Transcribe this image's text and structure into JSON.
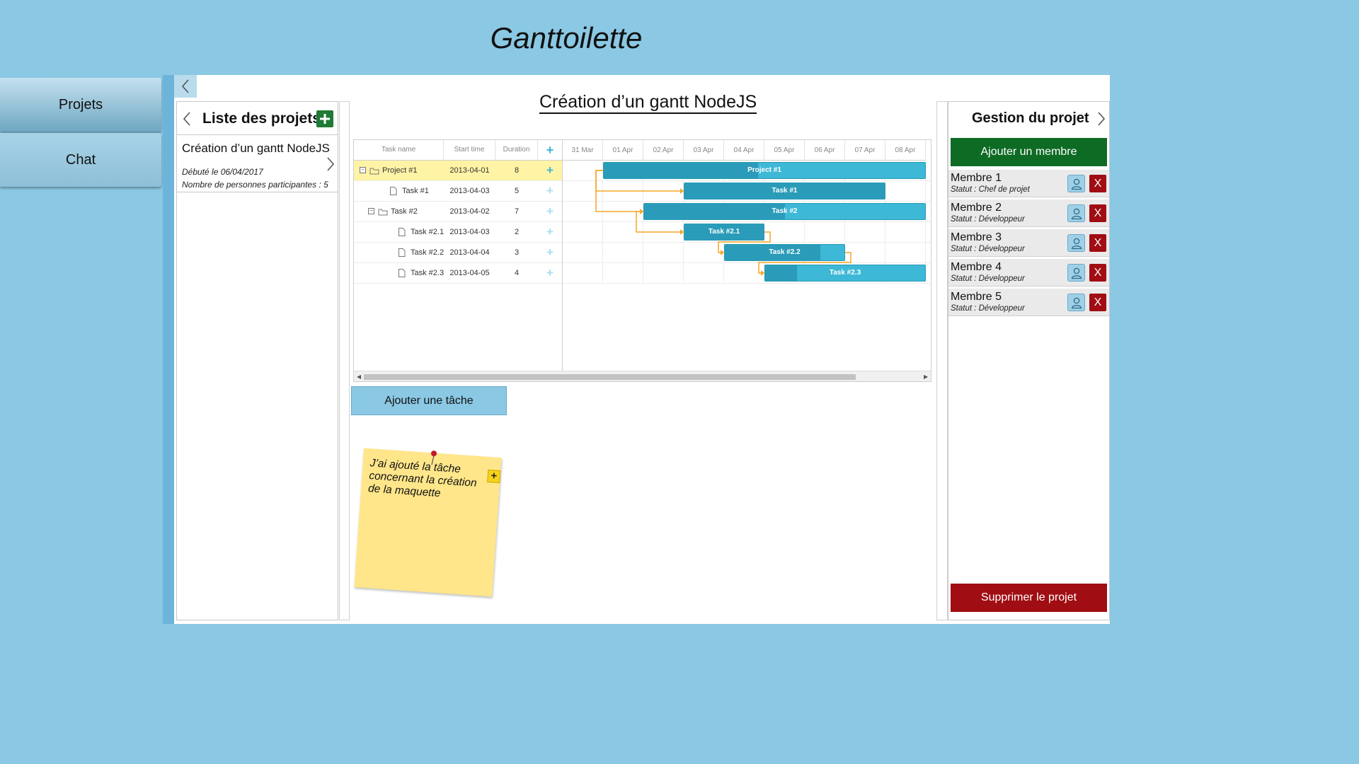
{
  "app": {
    "title": "Ganttoilette"
  },
  "sidebar": {
    "items": [
      {
        "label": "Projets"
      },
      {
        "label": "Chat"
      }
    ]
  },
  "projects_panel": {
    "title": "Liste des projets",
    "items": [
      {
        "name": "Création d’un gantt NodeJS",
        "started": "Débuté le 06/04/2017",
        "participants": "Nombre de personnes participantes : 5"
      }
    ]
  },
  "project": {
    "title": "Création d’un gantt NodeJS"
  },
  "gantt": {
    "columns": {
      "name": "Task name",
      "start": "Start time",
      "duration": "Duration",
      "add": "+"
    },
    "dates": [
      "31 Mar",
      "01 Apr",
      "02 Apr",
      "03 Apr",
      "04 Apr",
      "05 Apr",
      "06 Apr",
      "07 Apr",
      "08 Apr"
    ],
    "tasks": [
      {
        "name": "Project #1",
        "start": "2013-04-01",
        "duration": "8",
        "level": 0,
        "type": "folder",
        "progress": 0.48,
        "selected": true,
        "add": "+"
      },
      {
        "name": "Task #1",
        "start": "2013-04-03",
        "duration": "5",
        "level": 1,
        "type": "file",
        "progress": 1.0,
        "add": "+"
      },
      {
        "name": "Task #2",
        "start": "2013-04-02",
        "duration": "7",
        "level": 1,
        "type": "folder",
        "progress": 0.5,
        "add": "+"
      },
      {
        "name": "Task #2.1",
        "start": "2013-04-03",
        "duration": "2",
        "level": 2,
        "type": "file",
        "progress": 1.0,
        "add": "+"
      },
      {
        "name": "Task #2.2",
        "start": "2013-04-04",
        "duration": "3",
        "level": 2,
        "type": "file",
        "progress": 0.8,
        "add": "+"
      },
      {
        "name": "Task #2.3",
        "start": "2013-04-05",
        "duration": "4",
        "level": 2,
        "type": "file",
        "progress": 0.2,
        "add": "+"
      }
    ],
    "links": [
      [
        0,
        1
      ],
      [
        0,
        2
      ],
      [
        2,
        3
      ],
      [
        3,
        4
      ],
      [
        4,
        5
      ]
    ],
    "colors": {
      "bar": "#3db8d6",
      "progress": "#2a9bb8",
      "link": "#f5a623",
      "selected_row": "#fff3a6"
    }
  },
  "actions": {
    "add_task": "Ajouter une tâche"
  },
  "sticky_note": {
    "text": "J’ai ajouté la tâche concernant la création de la maquette",
    "add": "+"
  },
  "management": {
    "title": "Gestion du projet",
    "add_member": "Ajouter un membre",
    "members": [
      {
        "name": "Membre 1",
        "status": "Statut : Chef de projet"
      },
      {
        "name": "Membre 2",
        "status": "Statut : Développeur"
      },
      {
        "name": "Membre 3",
        "status": "Statut : Développeur"
      },
      {
        "name": "Membre 4",
        "status": "Statut : Développeur"
      },
      {
        "name": "Membre 5",
        "status": "Statut : Développeur"
      }
    ],
    "remove_label": "X",
    "delete_project": "Supprimer le projet"
  }
}
